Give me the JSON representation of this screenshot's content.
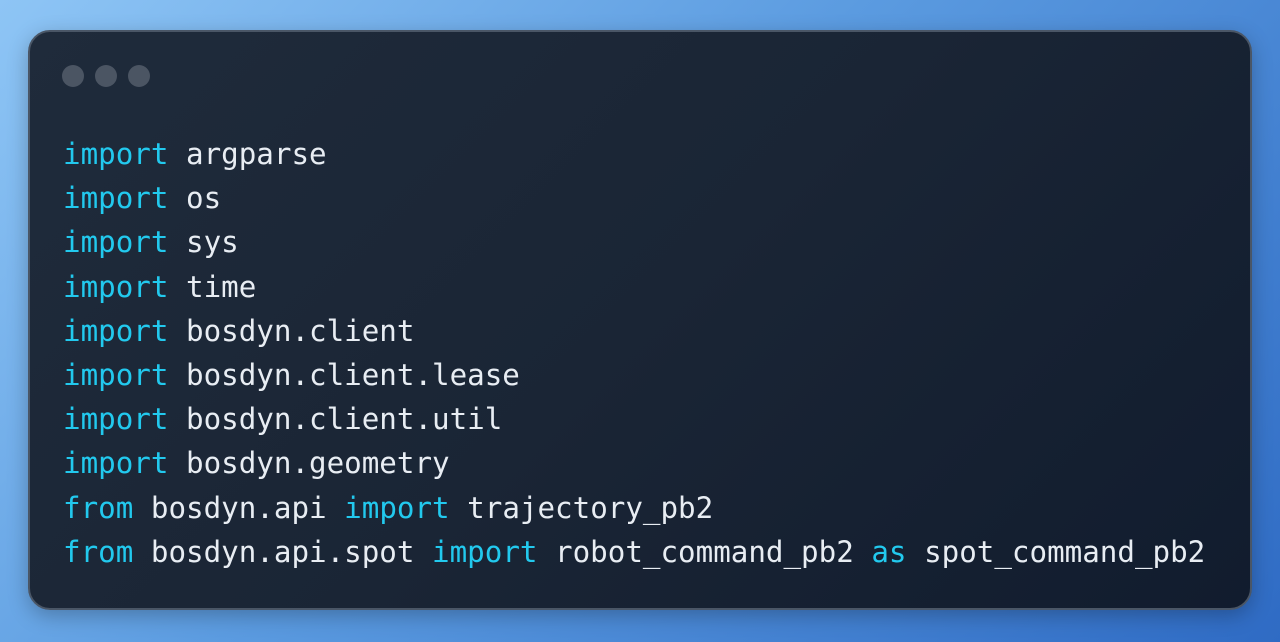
{
  "window_dots": [
    "close",
    "minimize",
    "maximize"
  ],
  "colors": {
    "keyword": "#22c9ee",
    "text": "#e8edf3",
    "background": "#1c2737"
  },
  "code_lines": [
    [
      {
        "t": "import",
        "k": true
      },
      {
        "t": " argparse",
        "k": false
      }
    ],
    [
      {
        "t": "import",
        "k": true
      },
      {
        "t": " os",
        "k": false
      }
    ],
    [
      {
        "t": "import",
        "k": true
      },
      {
        "t": " sys",
        "k": false
      }
    ],
    [
      {
        "t": "import",
        "k": true
      },
      {
        "t": " time",
        "k": false
      }
    ],
    [
      {
        "t": "import",
        "k": true
      },
      {
        "t": " bosdyn.client",
        "k": false
      }
    ],
    [
      {
        "t": "import",
        "k": true
      },
      {
        "t": " bosdyn.client.lease",
        "k": false
      }
    ],
    [
      {
        "t": "import",
        "k": true
      },
      {
        "t": " bosdyn.client.util",
        "k": false
      }
    ],
    [
      {
        "t": "import",
        "k": true
      },
      {
        "t": " bosdyn.geometry",
        "k": false
      }
    ],
    [
      {
        "t": "from",
        "k": true
      },
      {
        "t": " bosdyn.api ",
        "k": false
      },
      {
        "t": "import",
        "k": true
      },
      {
        "t": " trajectory_pb2",
        "k": false
      }
    ],
    [
      {
        "t": "from",
        "k": true
      },
      {
        "t": " bosdyn.api.spot ",
        "k": false
      },
      {
        "t": "import",
        "k": true
      },
      {
        "t": " robot_command_pb2 ",
        "k": false
      },
      {
        "t": "as",
        "k": true
      },
      {
        "t": " spot_command_pb2",
        "k": false
      }
    ]
  ]
}
